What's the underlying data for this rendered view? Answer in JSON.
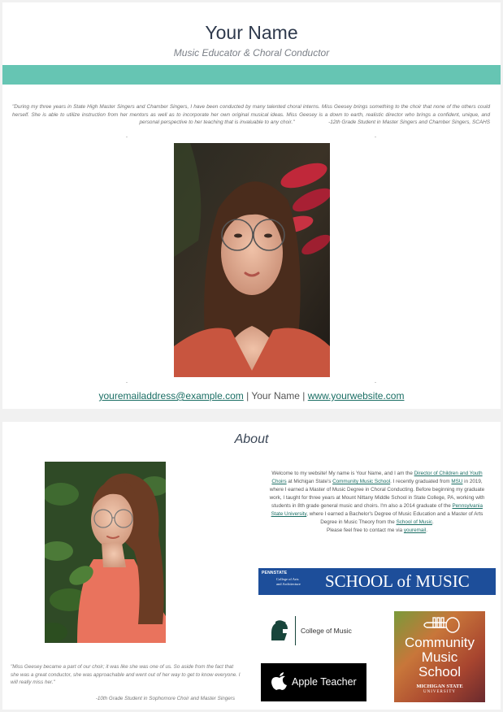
{
  "header": {
    "name": "Your Name",
    "subtitle": "Music Educator & Choral Conductor"
  },
  "testimonial_1": {
    "text": "\"During my three years in State High Master Singers and Chamber Singers, I have been conducted by many talented choral interns.  Miss Geesey brings something to the choir that none of the others could  herself.  She is able to utilize instruction from her mentors as well as to incorporate her own original musical ideas. Miss Geesey is a down to earth, realistic director who brings a confident, unique, and personal perspective to her teaching that is invaluable to any choir.\"",
    "attribution": "-12th Grade Student in Master Singers and Chamber Singers, SCAHS"
  },
  "contact": {
    "email": "youremailaddress@example.com",
    "separator": "|",
    "name": "Your Name",
    "website": "www.yourwebsite.com"
  },
  "about": {
    "title": "About",
    "bio": {
      "p1": "Welcome to my website! My name is Your Name, and I am the",
      "link_director": "Director of Children and Youth Choirs",
      "p2": "at Michigan State's",
      "link_cms": "Community Music School",
      "p3": ". I recently graduated from",
      "link_msu": "MSU",
      "p4": "in 2019, where I earned a Master of Music Degree in Choral Conducting. Before beginning my graduate work, I taught for three years at Mount Nittany Middle School in State College, PA, working with students in 8th grade general music and choirs. I'm also a 2014 graduate of the",
      "link_psu": "Pennsylvania State University",
      "p5": ", where I earned a Bachelor's Degree of Music Education and a Master of Arts Degree in Music Theory from the",
      "link_som": "School of Music",
      "p6": ".",
      "contact_line": "Please feel free to contact me via",
      "link_email": "youremail",
      "contact_end": "."
    },
    "testimonial_2": {
      "text": "\"Miss Geesey became a part of our choir; it was like she was one of us.  So aside from the fact that she was a great conductor, she was approachable and went out of her way to get to know everyone.  I will really miss her.\"",
      "attribution": "-10th Grade Student in Sophomore Choir and Master Singers"
    }
  },
  "logos": {
    "psu_school_of_music": {
      "small_line1": "PENNSTATE",
      "small_line2": "College of Arts",
      "small_line3": "and Architecture",
      "word": "SCHOOL of MUSIC",
      "bg": "#1d4e9a"
    },
    "msu_college_of_music": {
      "label": "College of Music",
      "color": "#18453b"
    },
    "apple_teacher": {
      "label": "Apple Teacher"
    },
    "community_music_school": {
      "line1": "Community",
      "line2": "Music",
      "line3": "School",
      "line4": "MICHIGAN STATE",
      "line5": "UNIVERSITY"
    }
  },
  "colors": {
    "accent_teal": "#66c5b3",
    "link": "#1a6e64"
  }
}
